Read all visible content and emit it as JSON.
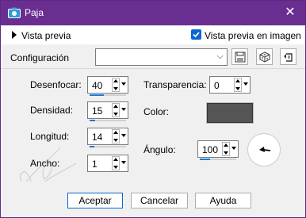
{
  "window": {
    "title": "Paja"
  },
  "preview": {
    "toggle_label": "Vista previa",
    "live_preview_label": "Vista previa en imagen",
    "live_preview_checked": true
  },
  "config": {
    "label": "Configuración",
    "value": ""
  },
  "fields": {
    "desenfocar": {
      "label": "Desenfocar:",
      "value": "40",
      "level": 0.4
    },
    "densidad": {
      "label": "Densidad:",
      "value": "15",
      "level": 0.15
    },
    "longitud": {
      "label": "Longitud:",
      "value": "14",
      "level": 0.14
    },
    "ancho": {
      "label": "Ancho:",
      "value": "1",
      "level": 0.0
    },
    "transparencia": {
      "label": "Transparencia:",
      "value": "0",
      "level": 0.0
    },
    "color": {
      "label": "Color:",
      "swatch": "#555555"
    },
    "angulo": {
      "label": "Ángulo:",
      "value": "100",
      "level": 0.28
    }
  },
  "buttons": {
    "ok": "Aceptar",
    "cancel": "Cancelar",
    "help": "Ayuda"
  },
  "colors": {
    "titlebar": "#6a2d90",
    "accent": "#0a66d3"
  }
}
